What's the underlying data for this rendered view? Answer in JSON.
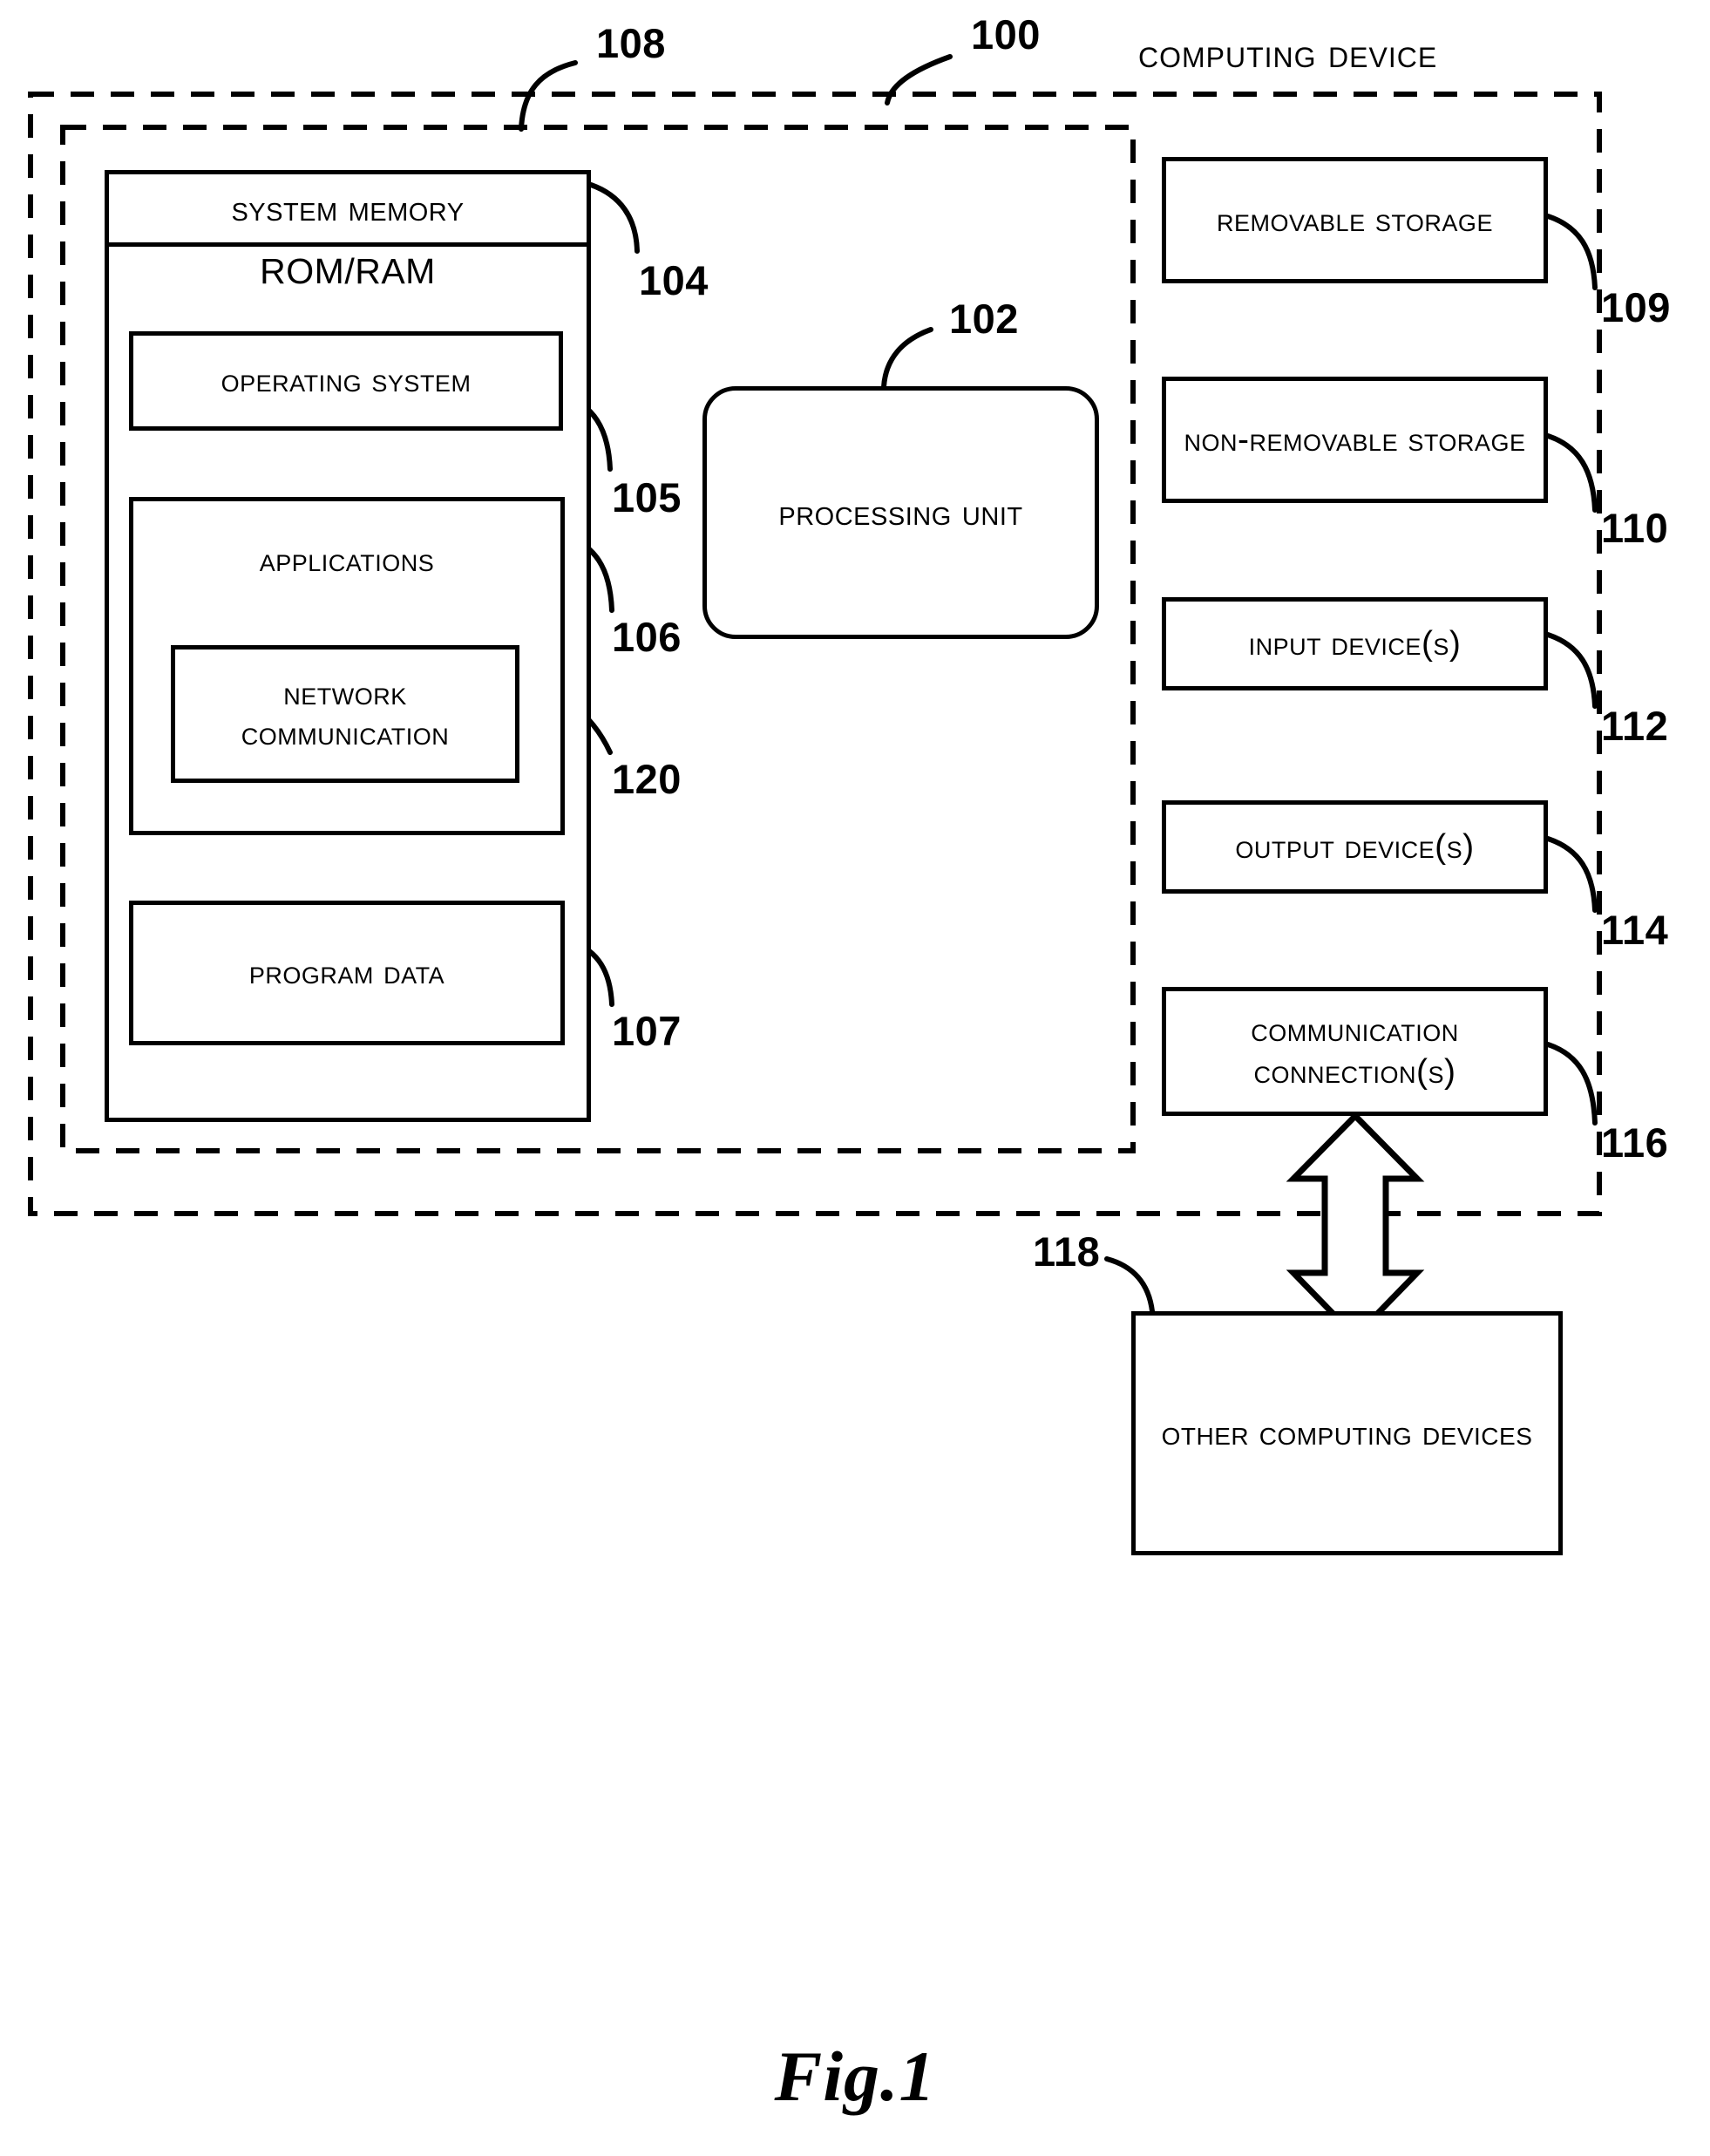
{
  "figure": {
    "caption": "Fig.1",
    "title": "Computing Device",
    "title_ref": "100"
  },
  "containers": [
    {
      "name": "computing-device-boundary",
      "ref": "100",
      "style": "dashed"
    },
    {
      "name": "system-memory-boundary",
      "ref": "108",
      "style": "dashed"
    }
  ],
  "memory": {
    "system_memory_label": "System Memory",
    "system_memory_ref": "104",
    "romram_label": "ROM/RAM",
    "operating_system_label": "Operating System",
    "operating_system_ref": "105",
    "applications_label": "Applications",
    "applications_ref": "106",
    "network_communication_label": "Network Communication",
    "network_communication_ref": "120",
    "program_data_label": "Program Data",
    "program_data_ref": "107"
  },
  "processor": {
    "label": "Processing Unit",
    "ref": "102"
  },
  "peripherals": [
    {
      "label": "Removable Storage",
      "ref": "109"
    },
    {
      "label": "Non-Removable Storage",
      "ref": "110"
    },
    {
      "label": "Input Device(s)",
      "ref": "112"
    },
    {
      "label": "Output Device(s)",
      "ref": "114"
    },
    {
      "label": "Communication Connection(s)",
      "ref": "116"
    }
  ],
  "external": {
    "label": "Other Computing Devices",
    "ref": "118"
  },
  "refs": {
    "r100": "100",
    "r102": "102",
    "r104": "104",
    "r105": "105",
    "r106": "106",
    "r107": "107",
    "r108": "108",
    "r109": "109",
    "r110": "110",
    "r112": "112",
    "r114": "114",
    "r116": "116",
    "r118": "118",
    "r120": "120"
  },
  "colors": {
    "ink": "#000000",
    "paper": "#ffffff"
  }
}
